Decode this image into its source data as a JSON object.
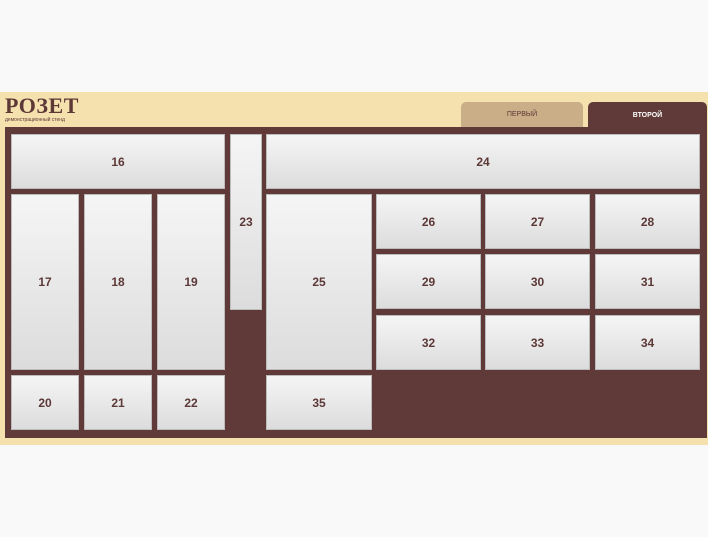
{
  "logo": {
    "title": "РОЗЕТ",
    "subtitle": "демонстрационный стенд"
  },
  "tabs": {
    "first": "ПЕРВЫЙ",
    "second": "ВТОРОЙ",
    "active": "second"
  },
  "cells": {
    "c16": "16",
    "c17": "17",
    "c18": "18",
    "c19": "19",
    "c20": "20",
    "c21": "21",
    "c22": "22",
    "c23": "23",
    "c24": "24",
    "c25": "25",
    "c26": "26",
    "c27": "27",
    "c28": "28",
    "c29": "29",
    "c30": "30",
    "c31": "31",
    "c32": "32",
    "c33": "33",
    "c34": "34",
    "c35": "35"
  },
  "colors": {
    "frame": "#5f3a39",
    "header": "#f5e1ad",
    "inactive_tab": "#c9ae87",
    "text": "#5c3837"
  }
}
